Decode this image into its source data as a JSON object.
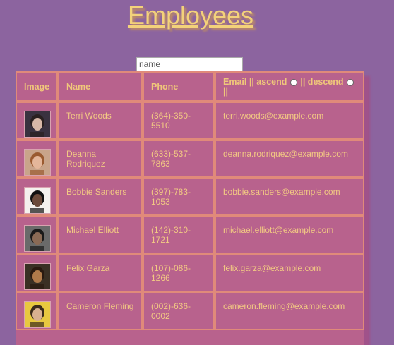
{
  "title": "Employees",
  "search": {
    "placeholder": "name"
  },
  "table": {
    "headers": {
      "image": "Image",
      "name": "Name",
      "phone": "Phone",
      "email": "Email || ascend",
      "sep": "|| descend",
      "end": "||"
    },
    "rows": [
      {
        "name": "Terri Woods",
        "phone": "(364)-350-5510",
        "email": "terri.woods@example.com",
        "avatar": {
          "bg": "#3a3240",
          "skin": "#d8b8a8",
          "hair": "#2a2020"
        }
      },
      {
        "name": "Deanna Rodriquez",
        "phone": "(633)-537-7863",
        "email": "deanna.rodriquez@example.com",
        "avatar": {
          "bg": "#c9a48a",
          "skin": "#e4b69a",
          "hair": "#9a5a30"
        }
      },
      {
        "name": "Bobbie Sanders",
        "phone": "(397)-783-1053",
        "email": "bobbie.sanders@example.com",
        "avatar": {
          "bg": "#f4f1ee",
          "skin": "#6b4a3a",
          "hair": "#111111"
        }
      },
      {
        "name": "Michael Elliott",
        "phone": "(142)-310-1721",
        "email": "michael.elliott@example.com",
        "avatar": {
          "bg": "#6a6a6a",
          "skin": "#8a6a55",
          "hair": "#1a1a1a"
        }
      },
      {
        "name": "Felix Garza",
        "phone": "(107)-086-1266",
        "email": "felix.garza@example.com",
        "avatar": {
          "bg": "#3a3024",
          "skin": "#b07a4a",
          "hair": "#2a1a10"
        }
      },
      {
        "name": "Cameron Fleming",
        "phone": "(002)-636-0002",
        "email": "cameron.fleming@example.com",
        "avatar": {
          "bg": "#e8c840",
          "skin": "#d8b090",
          "hair": "#3a2a1a"
        }
      }
    ]
  }
}
